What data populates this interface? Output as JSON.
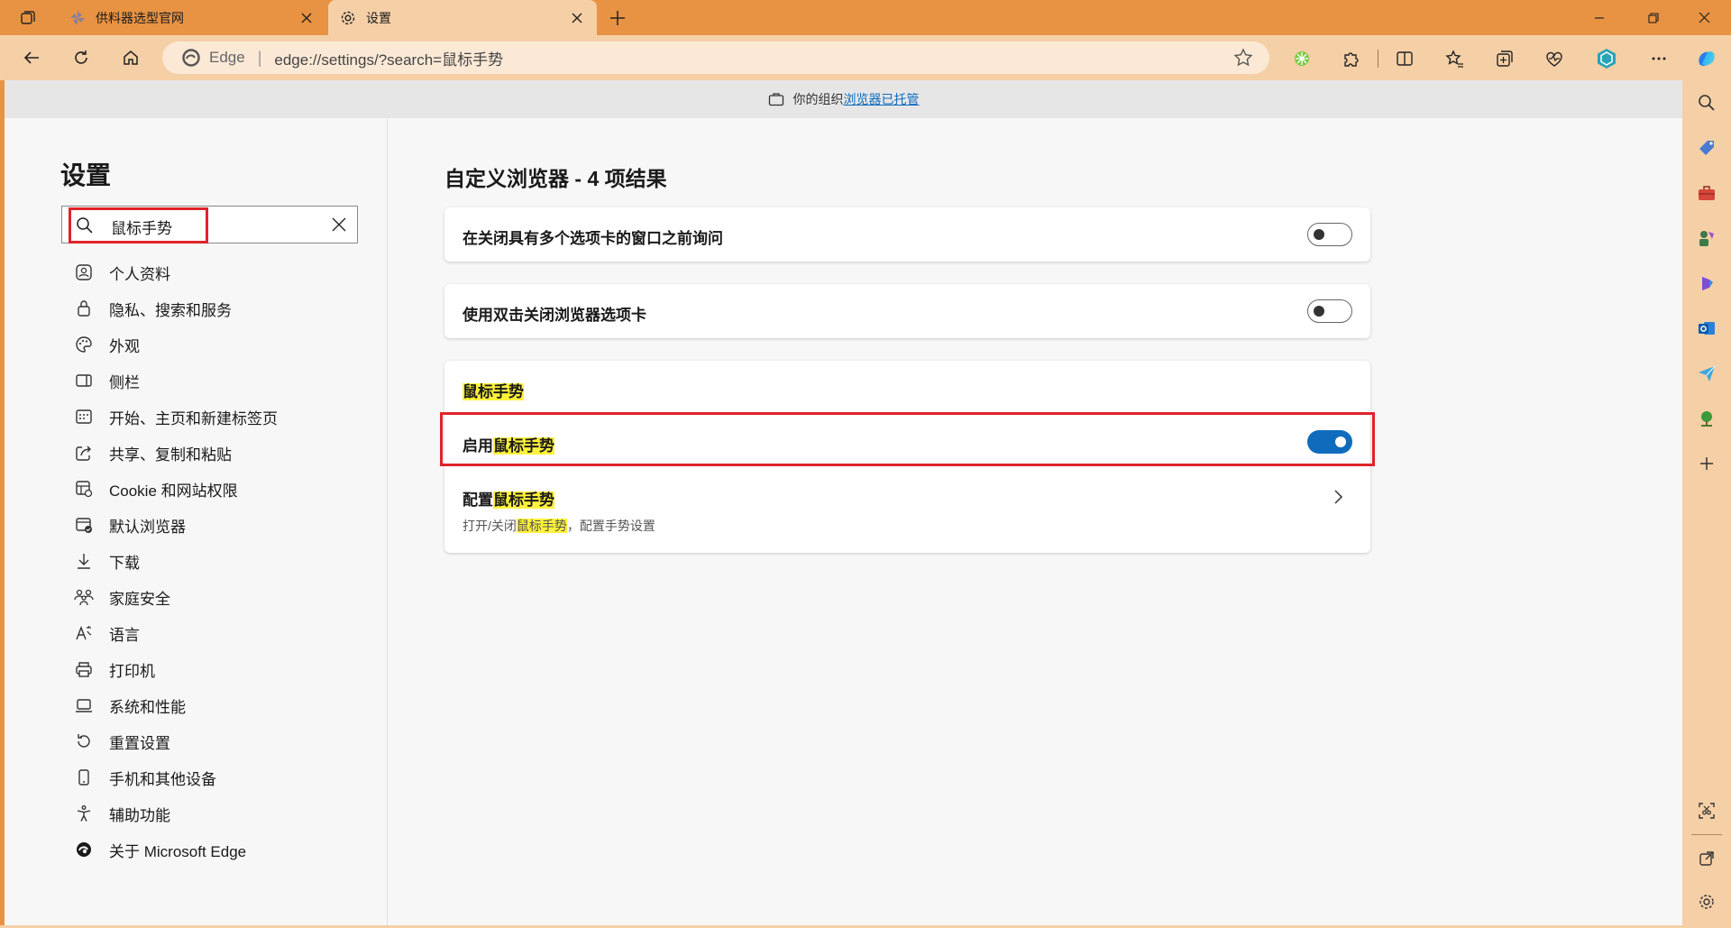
{
  "tabs": [
    {
      "title": "供料器选型官网",
      "icon": "pinwheel-icon",
      "active": false
    },
    {
      "title": "设置",
      "icon": "gear-icon",
      "active": true
    }
  ],
  "address": {
    "brand": "Edge",
    "url": "edge://settings/?search=鼠标手势"
  },
  "managed_bar": {
    "prefix": "你的组织",
    "link": "浏览器已托管"
  },
  "sidebar": {
    "title": "设置",
    "search_value": "鼠标手势",
    "items": [
      {
        "label": "个人资料",
        "icon": "profile-icon"
      },
      {
        "label": "隐私、搜索和服务",
        "icon": "lock-icon"
      },
      {
        "label": "外观",
        "icon": "palette-icon"
      },
      {
        "label": "侧栏",
        "icon": "sidebar-panel-icon"
      },
      {
        "label": "开始、主页和新建标签页",
        "icon": "home-grid-icon"
      },
      {
        "label": "共享、复制和粘贴",
        "icon": "share-icon"
      },
      {
        "label": "Cookie 和网站权限",
        "icon": "cookie-grid-icon"
      },
      {
        "label": "默认浏览器",
        "icon": "default-browser-icon"
      },
      {
        "label": "下载",
        "icon": "download-icon"
      },
      {
        "label": "家庭安全",
        "icon": "family-icon"
      },
      {
        "label": "语言",
        "icon": "language-icon"
      },
      {
        "label": "打印机",
        "icon": "printer-icon"
      },
      {
        "label": "系统和性能",
        "icon": "laptop-icon"
      },
      {
        "label": "重置设置",
        "icon": "reset-icon"
      },
      {
        "label": "手机和其他设备",
        "icon": "phone-icon"
      },
      {
        "label": "辅助功能",
        "icon": "accessibility-icon"
      },
      {
        "label": "关于 Microsoft Edge",
        "icon": "edge-logo-icon"
      }
    ]
  },
  "results": {
    "title": "自定义浏览器 - 4 项结果",
    "card1": {
      "label": "在关闭具有多个选项卡的窗口之前询问",
      "enabled": false
    },
    "card2": {
      "label": "使用双击关闭浏览器选项卡",
      "enabled": false
    },
    "gestures": {
      "heading": "鼠标手势",
      "enable_prefix": "启用",
      "enable_highlight": "鼠标手势",
      "enabled": true,
      "config_prefix": "配置",
      "config_highlight": "鼠标手势",
      "desc_prefix": "打开/关闭",
      "desc_highlight": "鼠标手势",
      "desc_suffix": "，配置手势设置"
    }
  },
  "colors": {
    "frame": "#e89343",
    "toolbar": "#f5cfa6",
    "accent": "#0f6cbd",
    "highlight": "#fff23a",
    "annotation": "#e0242a"
  }
}
